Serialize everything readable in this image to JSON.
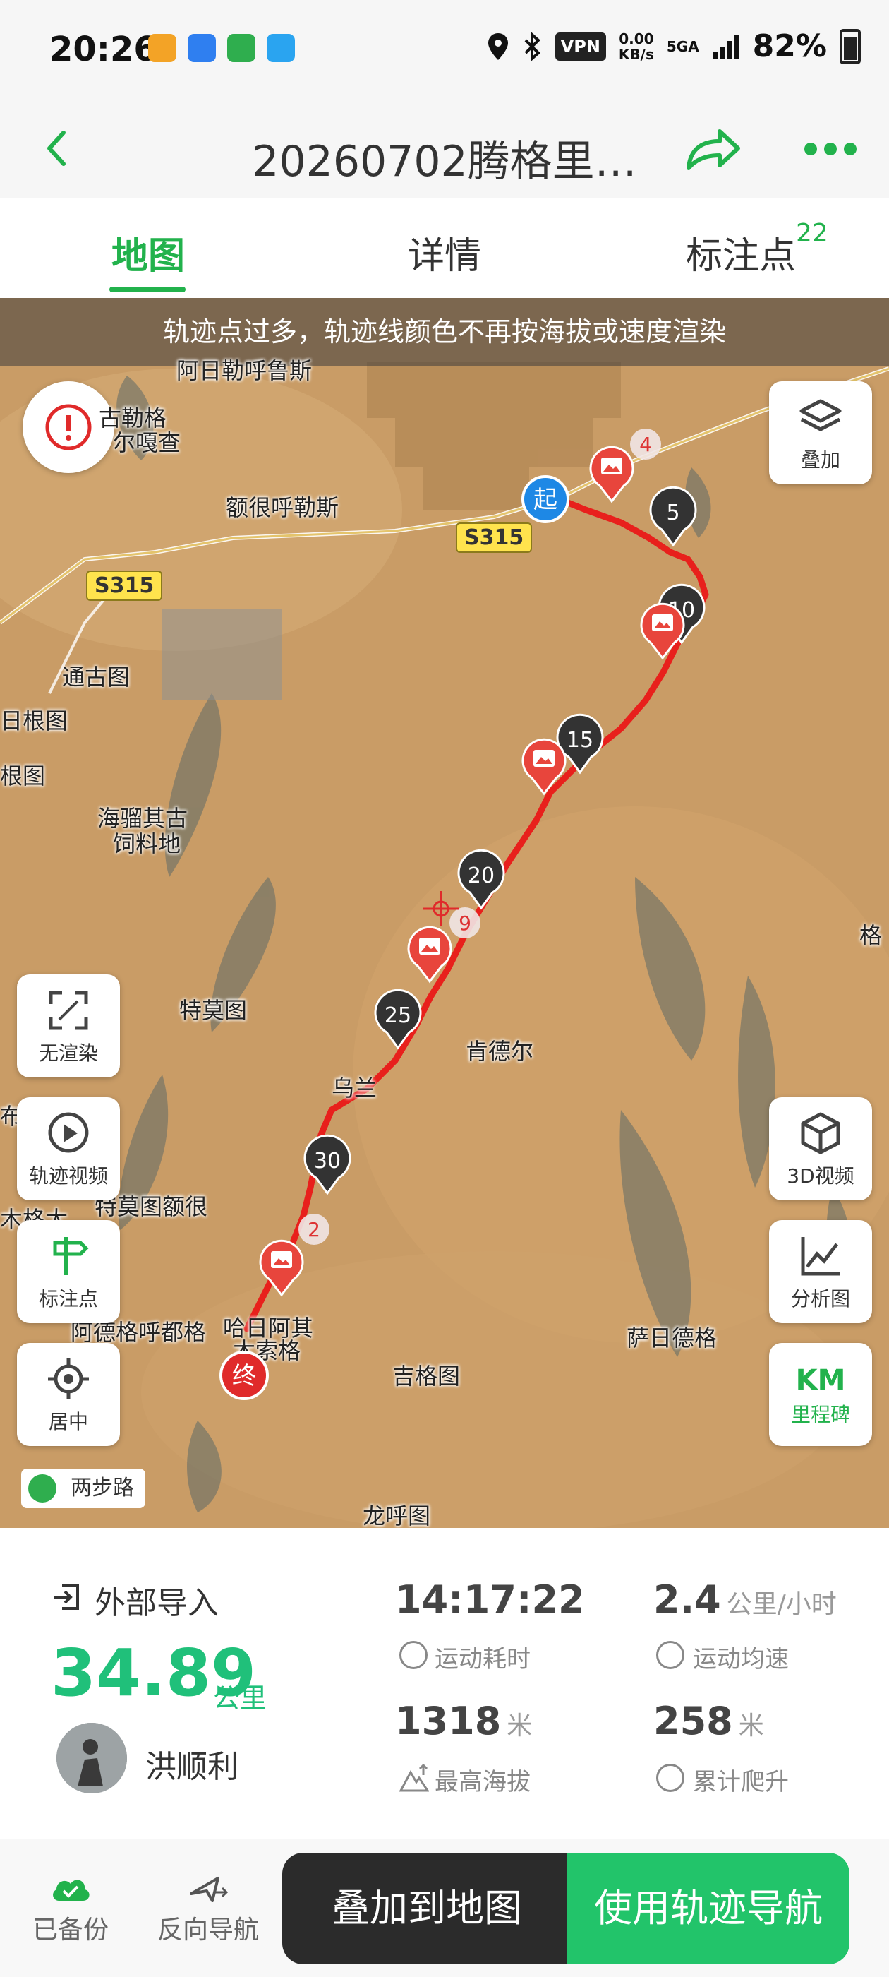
{
  "status_bar": {
    "time": "20:26",
    "net_speed_value": "0.00",
    "net_speed_unit": "KB/s",
    "vpn": "VPN",
    "signal": "5GA",
    "battery": "82%"
  },
  "header": {
    "title": "20260702腾格里…"
  },
  "tabs": [
    {
      "label": "地图",
      "active": true
    },
    {
      "label": "详情",
      "active": false
    },
    {
      "label": "标注点",
      "active": false,
      "badge": "22"
    }
  ],
  "map": {
    "banner": "轨迹点过多，轨迹线颜色不再按海拔或速度渲染",
    "places": [
      "阿日勒呼鲁斯",
      "古勒格",
      "尔嘎查",
      "额很呼勒斯",
      "通古图",
      "日根图",
      "根图",
      "海骝其古",
      "饲料地",
      "特莫图",
      "肯德尔",
      "乌兰",
      "特莫图额很",
      "阿德格呼都格",
      "哈日阿其",
      "木索格",
      "吉格图",
      "萨日德格",
      "龙呼图",
      "格",
      "布",
      "木格太"
    ],
    "roads": [
      "S315",
      "S315"
    ],
    "markers": {
      "start": "起",
      "end": "终",
      "km": [
        "5",
        "10",
        "15",
        "20",
        "25",
        "30"
      ],
      "annotations": [
        "4",
        "9",
        "2"
      ]
    },
    "left_buttons": [
      "无渲染",
      "轨迹视频",
      "标注点",
      "居中"
    ],
    "right_buttons": [
      "叠加",
      "3D视频",
      "分析图"
    ],
    "milestone": {
      "top": "KM",
      "bottom": "里程碑"
    },
    "brand": "两步路"
  },
  "stats": {
    "import_label": "外部导入",
    "distance": "34.89",
    "distance_unit": "公里",
    "username": "洪顺利",
    "duration": "14:17:22",
    "duration_label": "运动耗时",
    "avg_speed": "2.4",
    "avg_speed_unit": "公里/小时",
    "avg_speed_label": "运动均速",
    "max_alt": "1318",
    "max_alt_unit": "米",
    "max_alt_label": "最高海拔",
    "climb": "258",
    "climb_unit": "米",
    "climb_label": "累计爬升"
  },
  "bottom_bar": {
    "backed_up": "已备份",
    "reverse_nav": "反向导航",
    "overlay_btn": "叠加到地图",
    "use_track_btn": "使用轨迹导航"
  },
  "colors": {
    "accent": "#22b24c",
    "distance": "#20c07a",
    "track": "#e8201c"
  }
}
